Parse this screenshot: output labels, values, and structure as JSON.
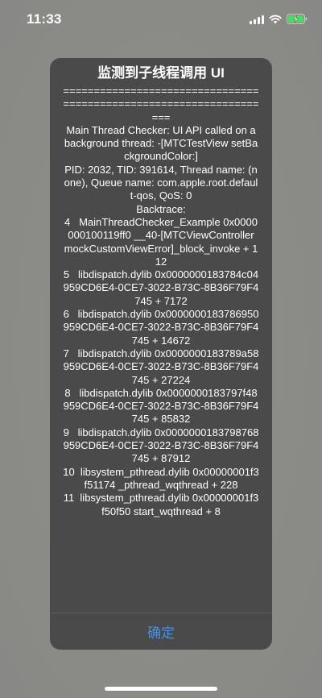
{
  "status_bar": {
    "time": "11:33",
    "icons": [
      "signal-icon",
      "wifi-icon",
      "battery-charging-icon"
    ],
    "battery_color": "#4cd964"
  },
  "alert": {
    "title": "监测到子线程调用 UI",
    "message": "===================================================================\nMain Thread Checker: UI API called on a background thread: -[MTCTestView setBackgroundColor:]\nPID: 2032, TID: 391614, Thread name: (none), Queue name: com.apple.root.default-qos, QoS: 0\nBacktrace:\n4   MainThreadChecker_Example 0x0000000100119ff0 __40-[MTCViewController mockCustomViewError]_block_invoke + 112\n5   libdispatch.dylib 0x0000000183784c04 959CD6E4-0CE7-3022-B73C-8B36F79F4745 + 7172\n6   libdispatch.dylib 0x0000000183786950 959CD6E4-0CE7-3022-B73C-8B36F79F4745 + 14672\n7   libdispatch.dylib 0x0000000183789a58 959CD6E4-0CE7-3022-B73C-8B36F79F4745 + 27224\n8   libdispatch.dylib 0x0000000183797f48 959CD6E4-0CE7-3022-B73C-8B36F79F4745 + 85832\n9   libdispatch.dylib 0x0000000183798768 959CD6E4-0CE7-3022-B73C-8B36F79F4745 + 87912\n10  libsystem_pthread.dylib 0x00000001f3f51174 _pthread_wqthread + 228\n11  libsystem_pthread.dylib 0x00000001f3f50f50 start_wqthread + 8",
    "confirm_label": "确定",
    "button_color": "#4a90e2"
  }
}
